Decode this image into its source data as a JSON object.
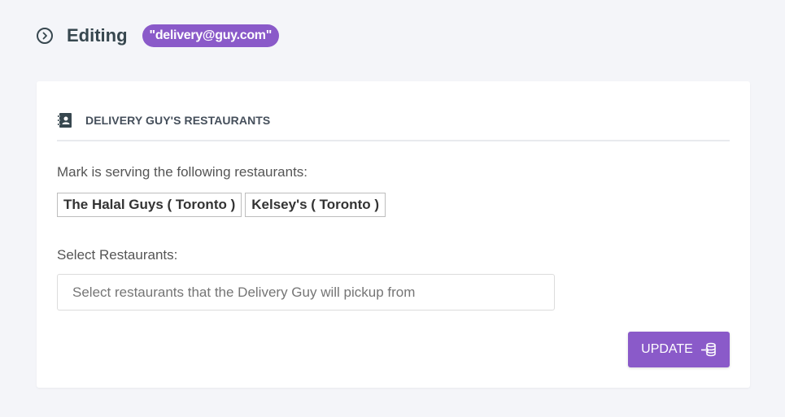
{
  "header": {
    "icon": "chevron-circle-right-icon",
    "title": "Editing",
    "badge": "\"delivery@guy.com\""
  },
  "card": {
    "icon": "contacts-book-icon",
    "title": "DELIVERY GUY'S RESTAURANTS",
    "serving_text": "Mark is serving the following restaurants:",
    "restaurants": [
      "The Halal Guys ( Toronto )",
      "Kelsey's ( Toronto )"
    ],
    "select_label": "Select Restaurants:",
    "select_placeholder": "Select restaurants that the Delivery Guy will pickup from",
    "update_label": "UPDATE",
    "update_icon": "database-import-icon"
  },
  "colors": {
    "accent": "#8a5ac9",
    "background": "#f4f5f9"
  }
}
